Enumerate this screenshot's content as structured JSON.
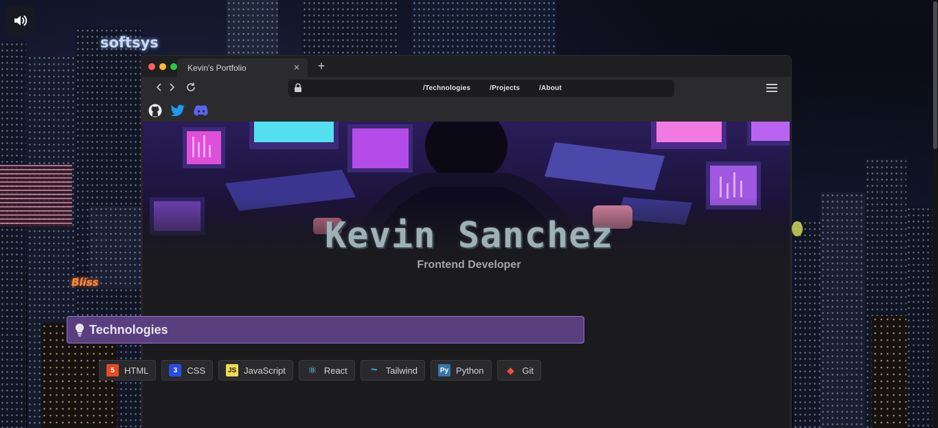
{
  "background": {
    "signs": [
      "softsys",
      "Bliss"
    ]
  },
  "sound_button": {
    "icon": "speaker-icon"
  },
  "browser": {
    "tab_title": "Kevin's Portfolio",
    "tab_close": "×",
    "new_tab": "+",
    "traffic_lights": [
      "#ff5f57",
      "#febc2e",
      "#28c840"
    ],
    "nav_links": [
      "/Technologies",
      "/Projects",
      "/About"
    ],
    "social_icons": [
      "github-icon",
      "twitter-icon",
      "discord-icon"
    ]
  },
  "hero": {
    "name": "Kevin Sanchez",
    "role": "Frontend Developer"
  },
  "technologies": {
    "title": "Technologies",
    "items": [
      {
        "label": "HTML",
        "color": "#e34c26",
        "glyph": "5"
      },
      {
        "label": "CSS",
        "color": "#264de4",
        "glyph": "3"
      },
      {
        "label": "JavaScript",
        "color": "#f0db4f",
        "glyph": "JS"
      },
      {
        "label": "React",
        "color": "#61dafb",
        "glyph": "⚛"
      },
      {
        "label": "Tailwind",
        "color": "#38bdf8",
        "glyph": "~"
      },
      {
        "label": "Python",
        "color": "#3776ab",
        "glyph": "Py"
      },
      {
        "label": "Git",
        "color": "#f05032",
        "glyph": "◆"
      }
    ]
  },
  "colors": {
    "accent": "#5a3f7e",
    "accent_border": "#9a6fd0",
    "twitter": "#1d9bf0",
    "discord": "#5865f2"
  }
}
